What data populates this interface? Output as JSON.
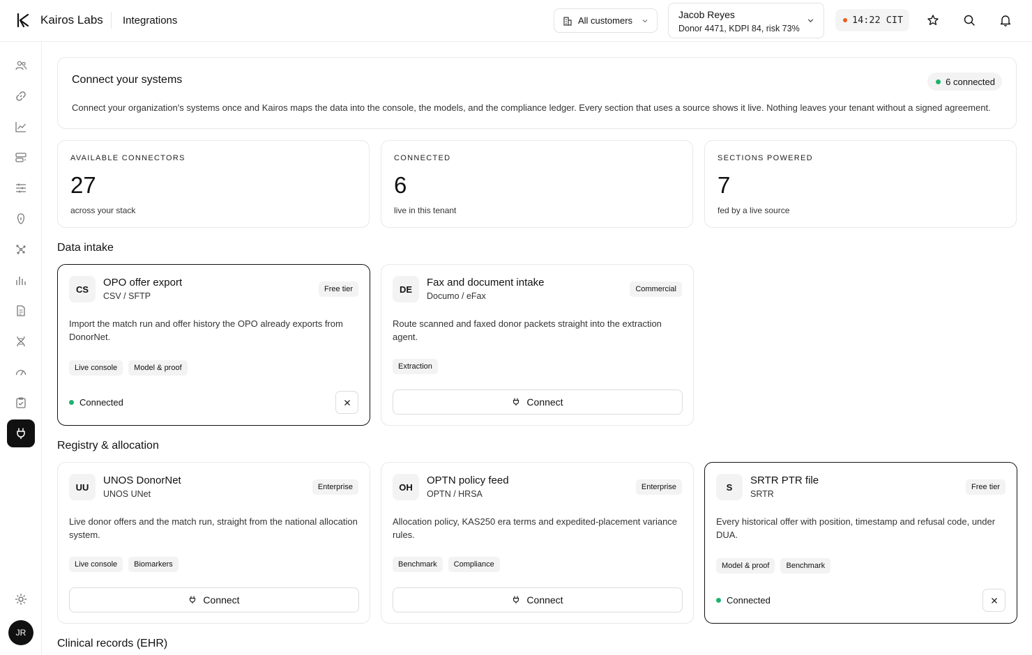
{
  "brand": {
    "name": "Kairos Labs",
    "logo_icon": "kairos-k-logo"
  },
  "header": {
    "crumb": "Integrations",
    "customers_label": "All customers",
    "donor": {
      "name": "Jacob Reyes",
      "meta": "Donor 4471, KDPI 84, risk 73%"
    },
    "clock": "14:22 CIT",
    "accent": "#f05a1a"
  },
  "sidebar": {
    "items": [
      "users-icon",
      "link-icon",
      "line-chart-icon",
      "server-icon",
      "sliders-icon",
      "kidney-icon",
      "network-icon",
      "bar-chart-icon",
      "document-icon",
      "dna-icon",
      "gauge-icon",
      "checklist-icon",
      "plug-icon"
    ],
    "active": "plug-icon",
    "avatar_initials": "JR"
  },
  "intro": {
    "title": "Connect your systems",
    "description": "Connect your organization's systems once and Kairos maps the data into the console, the models, and the compliance ledger. Every section that uses a source shows it live. Nothing leaves your tenant without a signed agreement.",
    "badge": "6 connected"
  },
  "stats": [
    {
      "label": "AVAILABLE CONNECTORS",
      "value": "27",
      "sub": "across your stack"
    },
    {
      "label": "CONNECTED",
      "value": "6",
      "sub": "live in this tenant"
    },
    {
      "label": "SECTIONS POWERED",
      "value": "7",
      "sub": "fed by a live source"
    }
  ],
  "sections": {
    "data_intake": "Data intake",
    "registry": "Registry & allocation",
    "clinical": "Clinical records (EHR)"
  },
  "connect_label": "Connect",
  "connected_label": "Connected",
  "status_color": "#1bb36e",
  "cards": {
    "opo": {
      "initials": "CS",
      "title": "OPO offer export",
      "vendor": "CSV / SFTP",
      "tier": "Free tier",
      "description": "Import the match run and offer history the OPO already exports from DonorNet.",
      "tags": [
        "Live console",
        "Model & proof"
      ]
    },
    "fax": {
      "initials": "DE",
      "title": "Fax and document intake",
      "vendor": "Documo / eFax",
      "tier": "Commercial",
      "description": "Route scanned and faxed donor packets straight into the extraction agent.",
      "tags": [
        "Extraction"
      ]
    },
    "unos": {
      "initials": "UU",
      "title": "UNOS DonorNet",
      "vendor": "UNOS UNet",
      "tier": "Enterprise",
      "description": "Live donor offers and the match run, straight from the national allocation system.",
      "tags": [
        "Live console",
        "Biomarkers"
      ]
    },
    "optn": {
      "initials": "OH",
      "title": "OPTN policy feed",
      "vendor": "OPTN / HRSA",
      "tier": "Enterprise",
      "description": "Allocation policy, KAS250 era terms and expedited-placement variance rules.",
      "tags": [
        "Benchmark",
        "Compliance"
      ]
    },
    "srtr": {
      "initials": "S",
      "title": "SRTR PTR file",
      "vendor": "SRTR",
      "tier": "Free tier",
      "description": "Every historical offer with position, timestamp and refusal code, under DUA.",
      "tags": [
        "Model & proof",
        "Benchmark"
      ]
    }
  }
}
